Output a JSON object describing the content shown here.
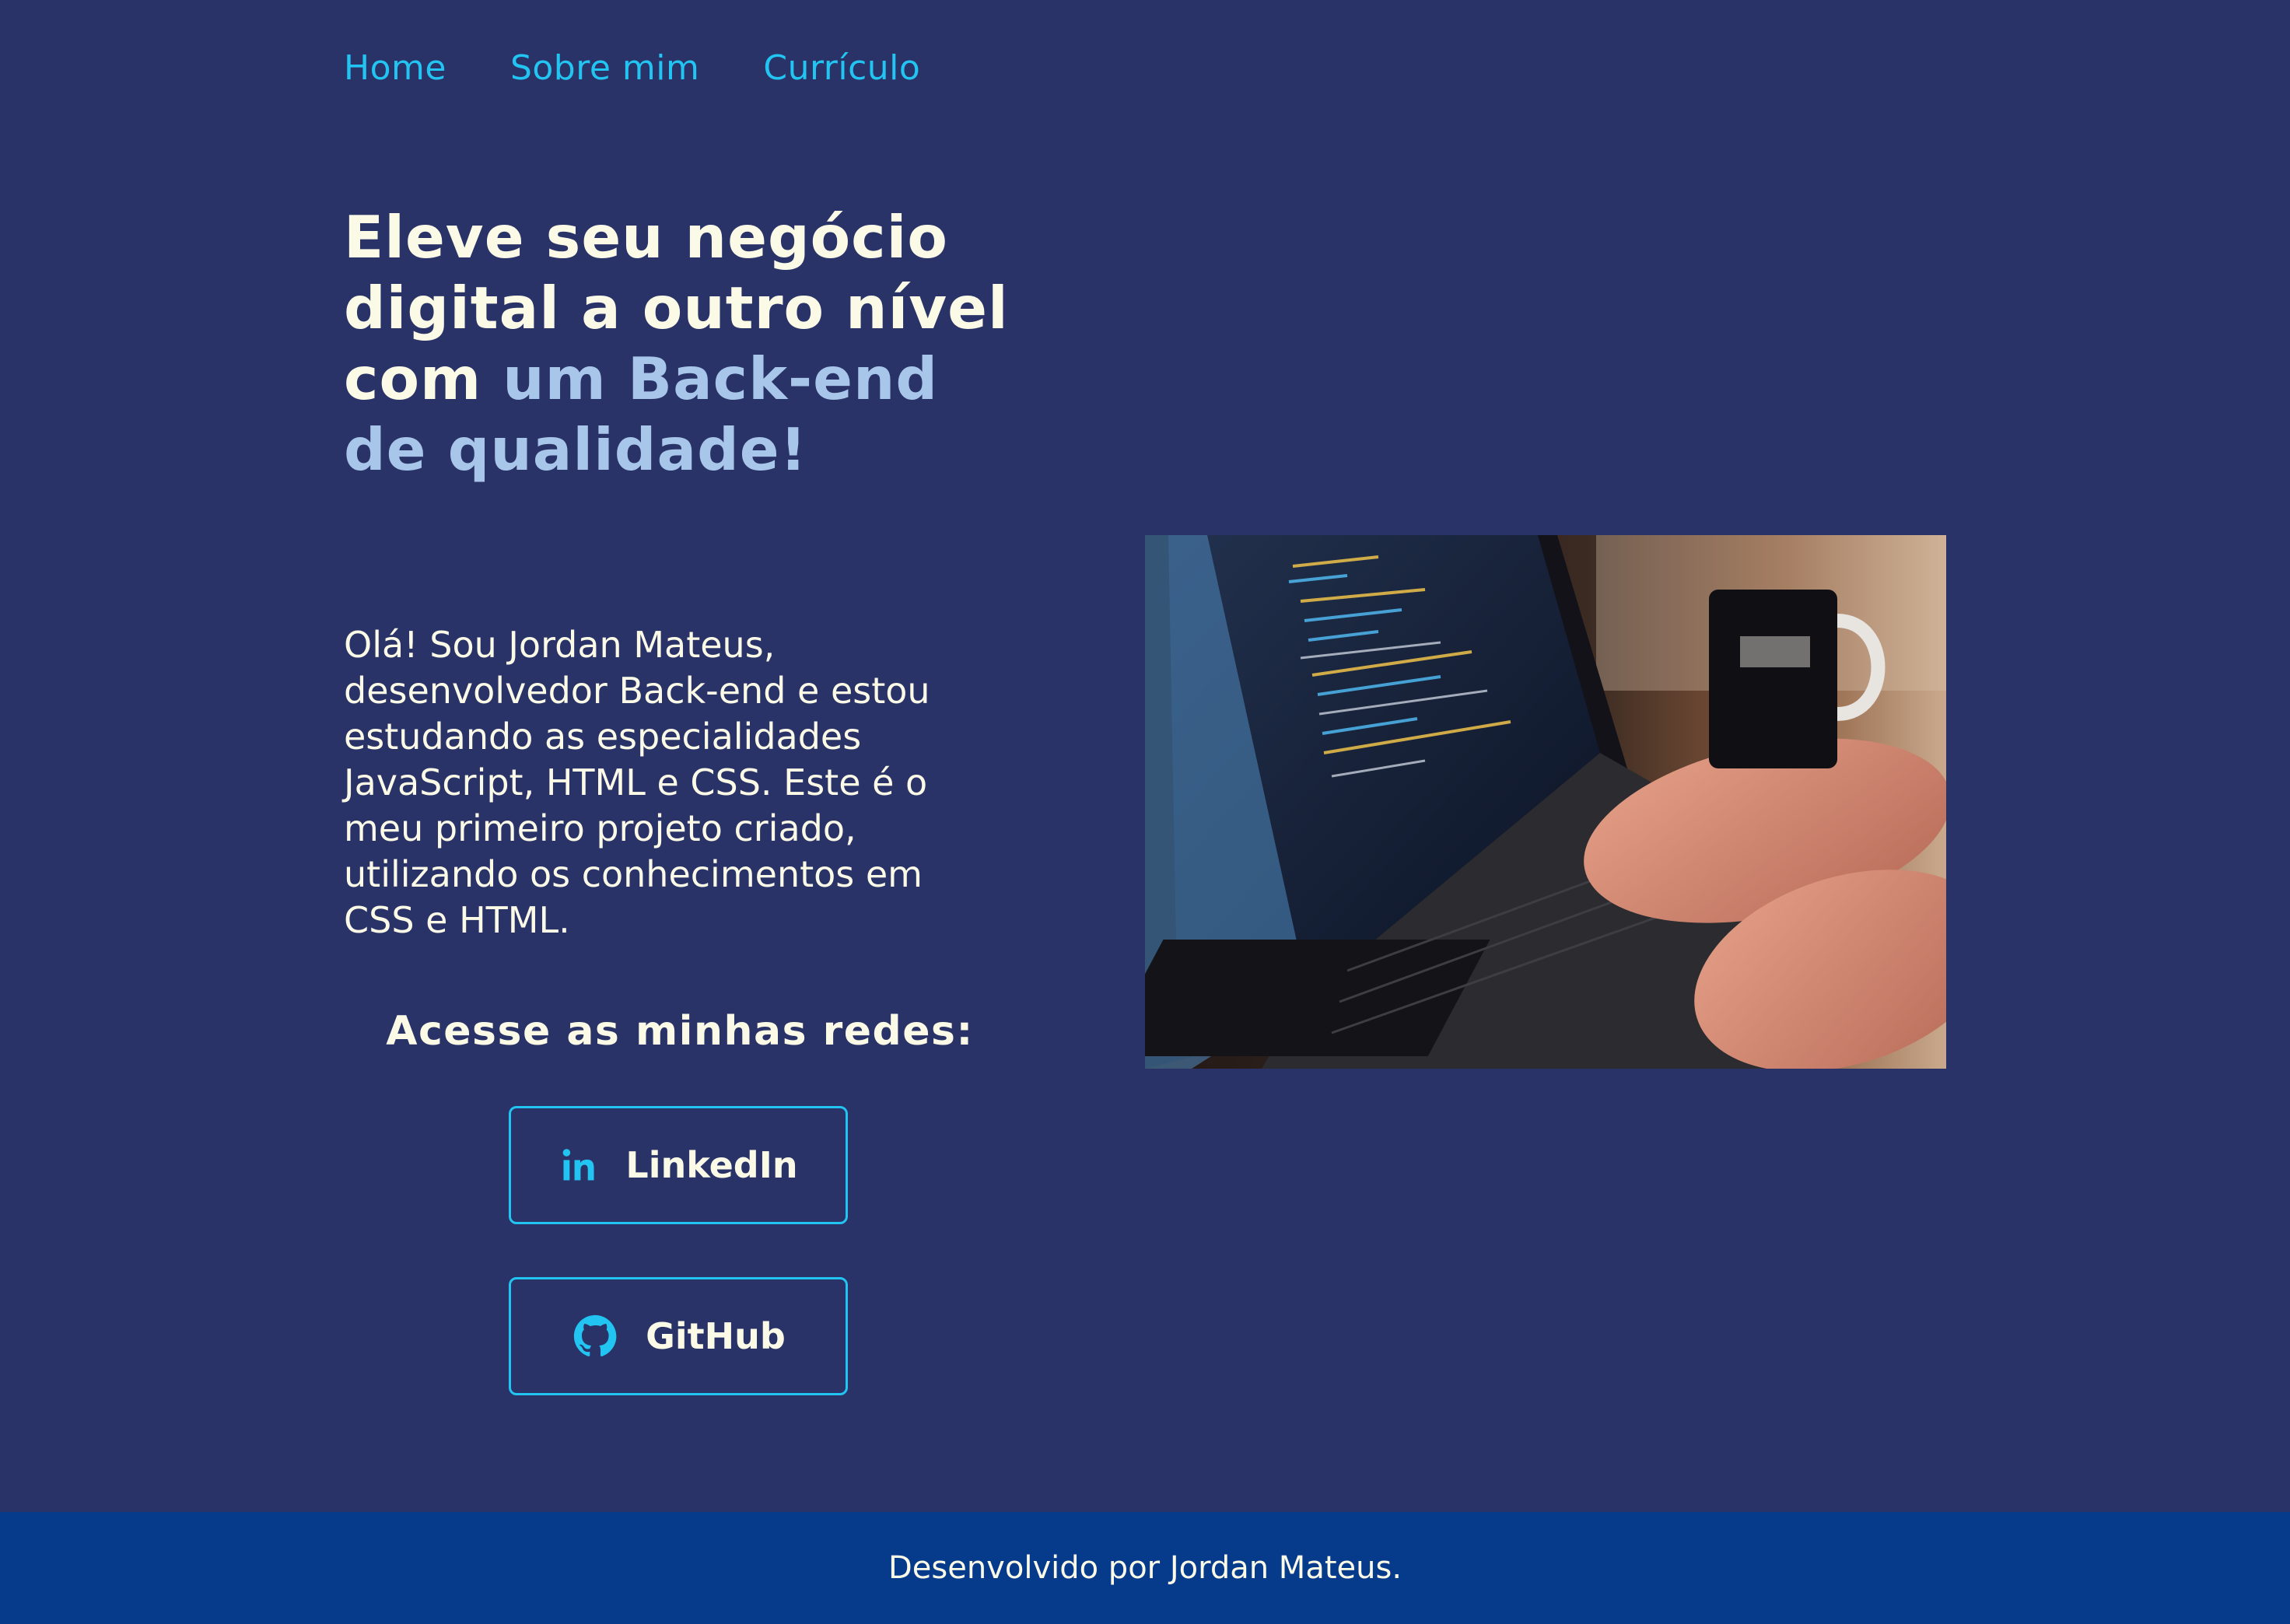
{
  "nav": {
    "items": [
      {
        "label": "Home"
      },
      {
        "label": "Sobre mim"
      },
      {
        "label": "Currículo"
      }
    ]
  },
  "hero": {
    "headline_main": "Eleve seu negócio digital a outro nível com ",
    "headline_accent": "um Back-end de qualidade!",
    "intro": "Olá! Sou Jordan Mateus, desenvolvedor Back-end e estou estudando as especialidades JavaScript, HTML e CSS. Este é o meu primeiro projeto criado, utilizando os conhecimentos em CSS e HTML.",
    "photo_subject": "laptop-with-code"
  },
  "socials": {
    "title": "Acesse as minhas redes:",
    "linkedin": {
      "label": "LinkedIn",
      "icon": "linkedin-icon"
    },
    "github": {
      "label": "GitHub",
      "icon": "github-icon"
    }
  },
  "footer": {
    "text": "Desenvolvido por Jordan Mateus."
  },
  "colors": {
    "background": "#2a3367",
    "accent": "#22c4f1",
    "headline_text": "#fbfae7",
    "headline_accent": "#a8c6ea",
    "footer_background": "#063b8c"
  }
}
